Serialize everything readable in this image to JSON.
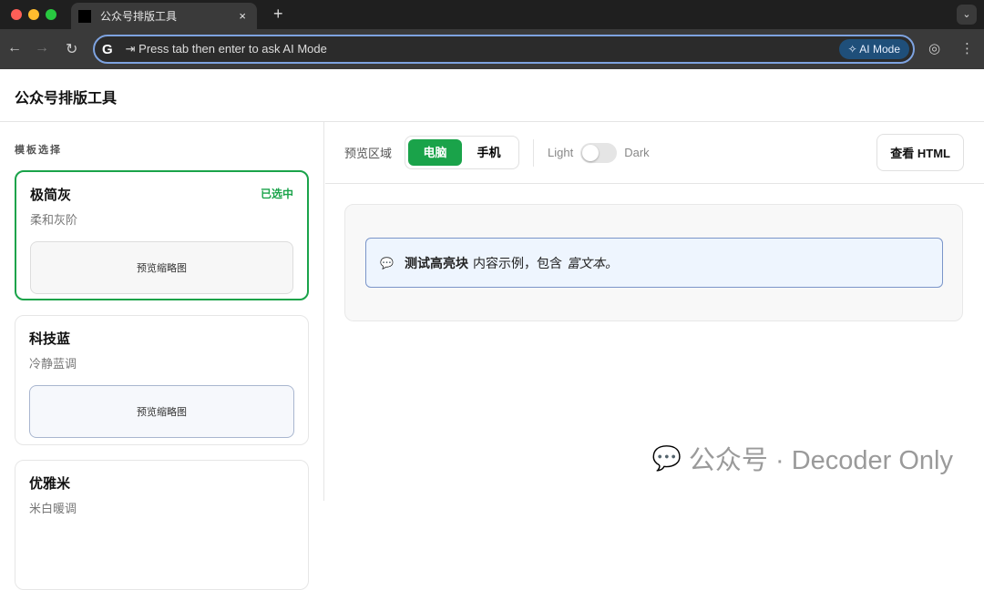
{
  "browser": {
    "tab_title": "公众号排版工具",
    "tab_close": "×",
    "new_tab": "+",
    "omnibox_text": "⇥ Press tab then enter to ask AI Mode",
    "ai_mode": "AI Mode"
  },
  "app": {
    "title": "公众号排版工具"
  },
  "sidebar": {
    "section_title": "模板选择",
    "templates": [
      {
        "name": "极简灰",
        "desc": "柔和灰阶",
        "badge": "已选中",
        "thumb": "预览缩略图"
      },
      {
        "name": "科技蓝",
        "desc": "冷静蓝调",
        "thumb": "预览缩略图"
      },
      {
        "name": "优雅米",
        "desc": "米白暖调"
      }
    ]
  },
  "toolbar": {
    "preview_label": "预览区域",
    "device_options": [
      "电脑",
      "手机"
    ],
    "selected_device": "电脑",
    "light": "Light",
    "dark": "Dark",
    "dark_mode": false,
    "view_html": "查看 HTML"
  },
  "preview": {
    "bold": "测试高亮块",
    "text": "内容示例，包含",
    "italic": "富文本。"
  },
  "watermark": "公众号 · Decoder Only",
  "colors": {
    "accent": "#1aa34a",
    "highlight_border": "#7b95c9",
    "highlight_bg": "#eef5fe"
  }
}
